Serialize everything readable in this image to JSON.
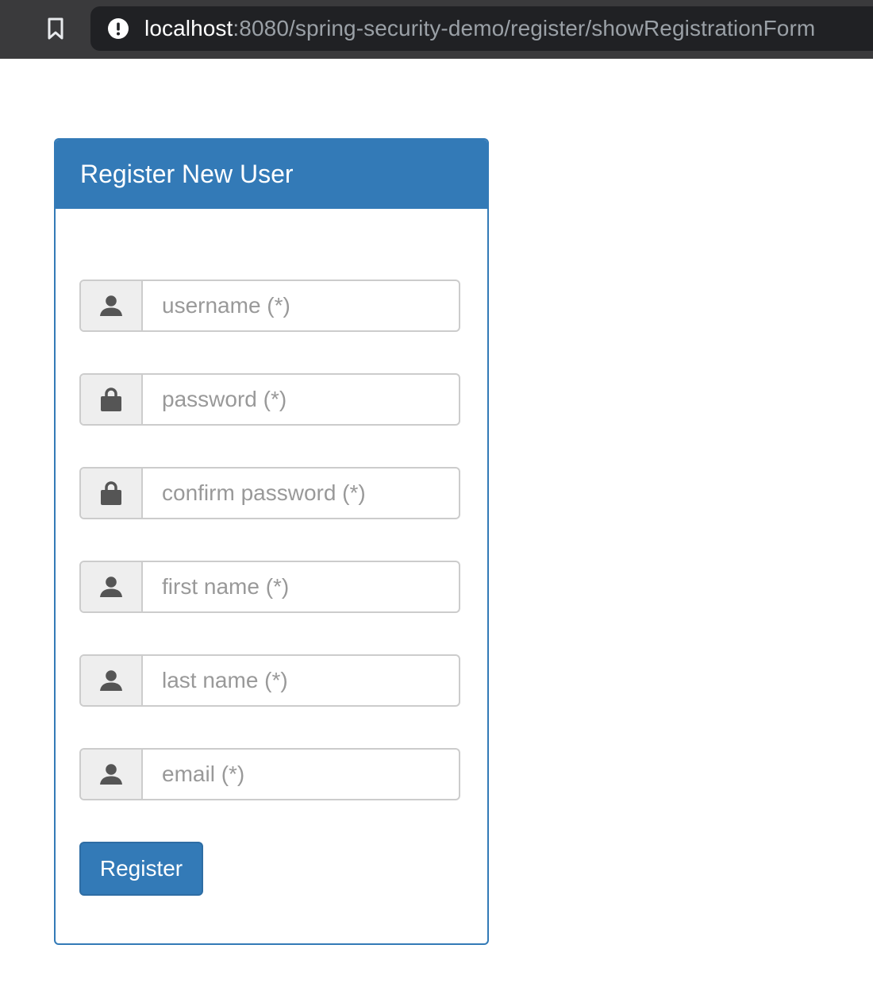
{
  "browser": {
    "url_host": "localhost",
    "url_rest": ":8080/spring-security-demo/register/showRegistrationForm",
    "icons": {
      "bookmark": "bookmark-icon",
      "site_info": "info-icon"
    }
  },
  "panel": {
    "title": "Register New User",
    "fields": [
      {
        "placeholder": "username (*)",
        "icon": "user-icon",
        "type": "text"
      },
      {
        "placeholder": "password (*)",
        "icon": "lock-icon",
        "type": "password"
      },
      {
        "placeholder": "confirm password (*)",
        "icon": "lock-icon",
        "type": "password"
      },
      {
        "placeholder": "first name (*)",
        "icon": "user-icon",
        "type": "text"
      },
      {
        "placeholder": "last name (*)",
        "icon": "user-icon",
        "type": "text"
      },
      {
        "placeholder": "email (*)",
        "icon": "user-icon",
        "type": "text"
      }
    ],
    "submit_label": "Register"
  },
  "colors": {
    "primary": "#337ab7",
    "addon_bg": "#eeeeee",
    "border": "#cccccc",
    "browser_bar": "#3a3a3c",
    "url_field": "#202124"
  }
}
